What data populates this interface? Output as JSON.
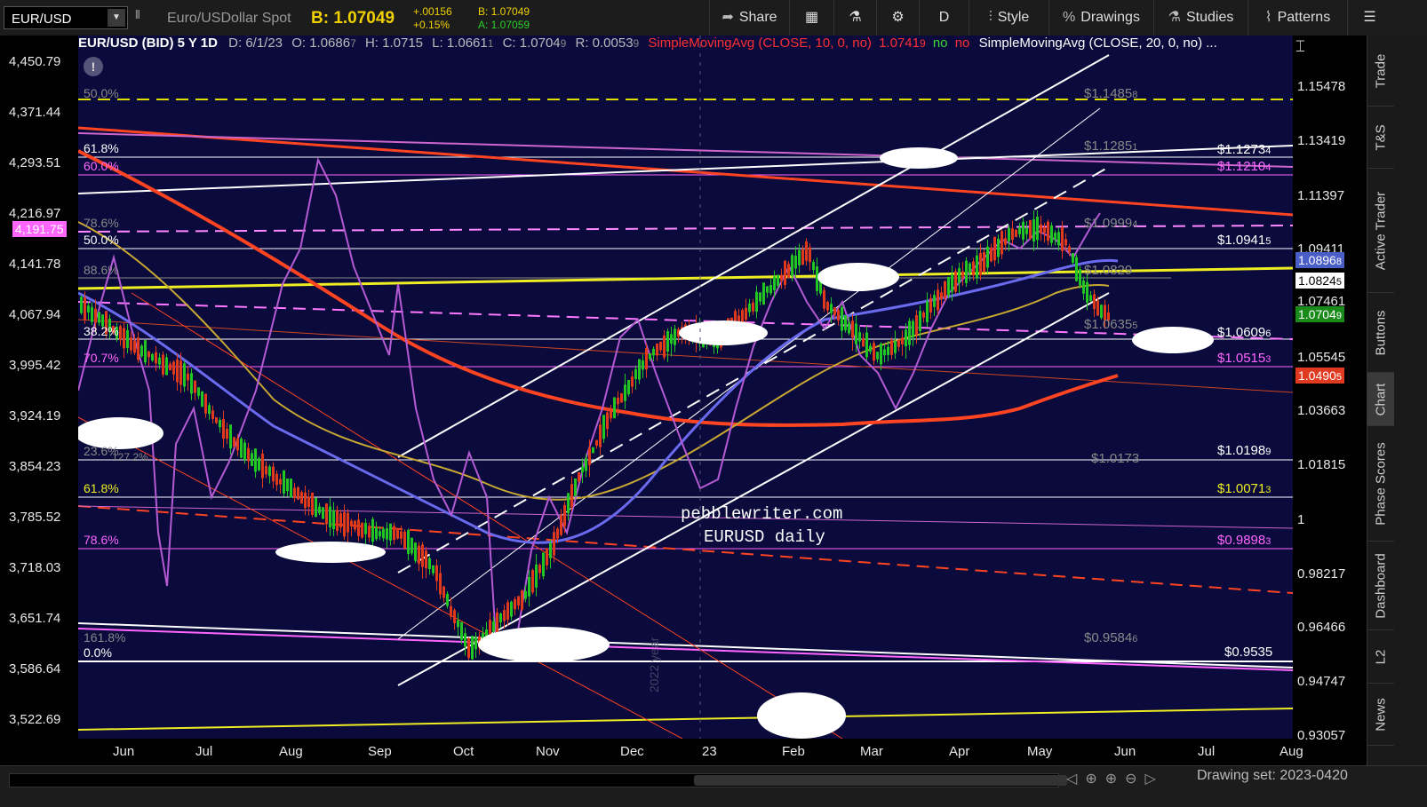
{
  "toolbar": {
    "symbol": "EUR/USD",
    "description": "Euro/USDollar Spot",
    "bid_label": "B: 1.07049",
    "change": "+.00156",
    "change_pct": "+0.15%",
    "bid_small": "B: 1.07049",
    "ask_small": "A: 1.07059",
    "buttons": {
      "share": "Share",
      "period": "D",
      "style": "Style",
      "drawings": "Drawings",
      "studies": "Studies",
      "patterns": "Patterns"
    }
  },
  "chart_header": {
    "title": "EUR/USD (BID) 5 Y 1D",
    "date": "D: 6/1/23",
    "open": "O: 1.0686",
    "open_sub": "7",
    "high": "H: 1.0715",
    "low": "L: 1.0661",
    "low_sub": "1",
    "close": "C: 1.0704",
    "close_sub": "9",
    "range": "R: 0.0053",
    "range_sub": "9",
    "sma10": "SimpleMovingAvg (CLOSE, 10, 0, no)",
    "sma10_val": "1.0741",
    "sma10_sub": "9",
    "no1": "no",
    "no2": "no",
    "sma20": "SimpleMovingAvg (CLOSE, 20, 0, no) ..."
  },
  "left_axis": [
    "4,450.79",
    "4,371.44",
    "4,293.51",
    "4,216.97",
    "4,141.78",
    "4,067.94",
    "3,995.42",
    "3,924.19",
    "3,854.23",
    "3,785.52",
    "3,718.03",
    "3,651.74",
    "3,586.64",
    "3,522.69"
  ],
  "left_badge": "4,191.75",
  "right_axis": [
    "1.15478",
    "1.13419",
    "1.11397",
    "1.09411",
    "1.05545",
    "1.03663",
    "1.01815",
    "1",
    "0.98217",
    "0.96466",
    "0.94747",
    "0.93057"
  ],
  "right_badges": {
    "b1": "1.0896",
    "b1_sub": "8",
    "b2": "1.0824",
    "b2_sub": "5",
    "b3": "1.0704",
    "b3_sub": "9",
    "b4": "1.0490",
    "b4_sub": "5",
    "r1": "1.07461"
  },
  "x_axis": [
    "Jun",
    "Jul",
    "Aug",
    "Sep",
    "Oct",
    "Nov",
    "Dec",
    "23",
    "Feb",
    "Mar",
    "Apr",
    "May",
    "Jun",
    "Jul",
    "Aug"
  ],
  "fib_labels": {
    "f50_top": "50.0%",
    "f618_top": "61.8%",
    "f600": "60.0%",
    "f786": "78.6%",
    "f500": "50.0%",
    "f886": "88.6%",
    "f382": "38.2%",
    "f707": "70.7%",
    "f236": "23.6%",
    "f227": "127.2%",
    "f618_low": "61.8%",
    "f786_low": "78.6%",
    "f1618": "161.8%",
    "f000": "0.0%"
  },
  "level_labels": {
    "l11485": "$1.1485",
    "l11485_sub": "8",
    "l11285": "$1.1285",
    "l11285_sub": "1",
    "l11273": "$1.1273",
    "l11273_sub": "4",
    "l11210": "$1.1210",
    "l11210_sub": "4",
    "l10999": "$1.0999",
    "l10999_sub": "4",
    "l10941": "$1.0941",
    "l10941_sub": "5",
    "l10829": "$1.0829",
    "l10635": "$1.0635",
    "l10635_sub": "5",
    "l10609": "$1.0609",
    "l10609_sub": "6",
    "l10515": "$1.0515",
    "l10515_sub": "3",
    "l10198": "$1.0198",
    "l10198_sub": "9",
    "l10173": "$1.0173",
    "l10071": "$1.0071",
    "l10071_sub": "3",
    "l09898": "$0.9898",
    "l09898_sub": "3",
    "l09584": "$0.9584",
    "l09584_sub": "6",
    "l09535": "$0.9535"
  },
  "annotation": {
    "line1": "pebblewriter.com",
    "line2": "EURUSD daily",
    "year_marker": "2022 year"
  },
  "sidebar_tabs": [
    "Trade",
    "T&S",
    "Active Trader",
    "Buttons",
    "Chart",
    "Phase Scores",
    "Dashboard",
    "L2",
    "News"
  ],
  "status": {
    "drawing_set": "Drawing set: 2023-0420"
  },
  "colors": {
    "plot_bg": "#0a0a3c",
    "bid_yellow": "#f0d000",
    "fib_pink": "#ff66ff",
    "sma_red": "#ff4422",
    "channel_white": "#ffffff",
    "badge_blue": "#4a5ec8",
    "badge_green": "#1a8a1a",
    "badge_red": "#e03a20"
  },
  "chart_data": {
    "type": "candlestick",
    "series_symbol": "EUR/USD",
    "timeframe": "5 Y 1D",
    "x_range": [
      "May 2022",
      "Aug 2023"
    ],
    "y_range_right": [
      0.9306,
      1.1548
    ],
    "last_close": 1.07049
  }
}
